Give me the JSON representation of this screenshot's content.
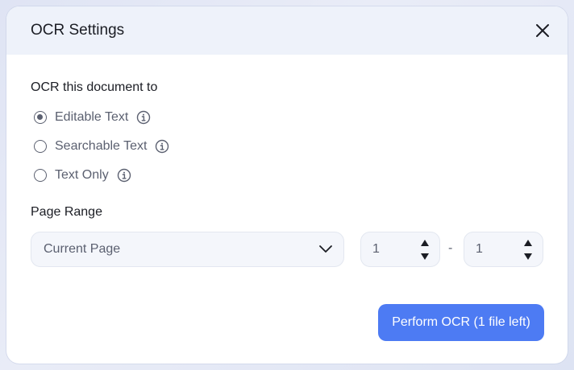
{
  "dialog": {
    "title": "OCR Settings",
    "close_icon": "close-icon"
  },
  "ocr_mode": {
    "label": "OCR this document to",
    "options": [
      {
        "label": "Editable Text",
        "selected": true,
        "icon": "info-icon"
      },
      {
        "label": "Searchable Text",
        "selected": false,
        "icon": "info-icon"
      },
      {
        "label": "Text Only",
        "selected": false,
        "icon": "info-icon"
      }
    ]
  },
  "page_range": {
    "label": "Page Range",
    "selected": "Current Page",
    "from": "1",
    "separator": "-",
    "to": "1"
  },
  "actions": {
    "perform_label": "Perform OCR (1 file left)"
  },
  "colors": {
    "accent": "#4d7bf3",
    "header_bg": "#eef2fa",
    "text_primary": "#1b1d24",
    "text_secondary": "#5b6070"
  }
}
